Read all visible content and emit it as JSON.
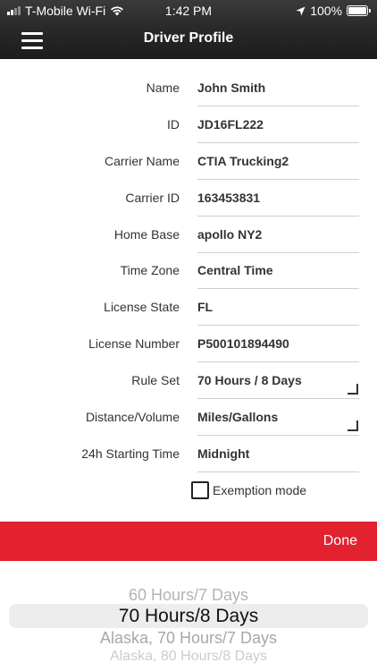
{
  "status_bar": {
    "carrier": "T-Mobile Wi-Fi",
    "time": "1:42 PM",
    "battery": "100%"
  },
  "header": {
    "title": "Driver Profile"
  },
  "fields": [
    {
      "label": "Name",
      "value": "John Smith"
    },
    {
      "label": "ID",
      "value": "JD16FL222"
    },
    {
      "label": "Carrier Name",
      "value": "CTIA Trucking2"
    },
    {
      "label": "Carrier ID",
      "value": "163453831"
    },
    {
      "label": "Home Base",
      "value": "apollo NY2"
    },
    {
      "label": "Time Zone",
      "value": "Central Time"
    },
    {
      "label": "License State",
      "value": "FL"
    },
    {
      "label": "License Number",
      "value": "P500101894490"
    },
    {
      "label": "Rule Set",
      "value": "70 Hours / 8 Days"
    },
    {
      "label": "Distance/Volume",
      "value": "Miles/Gallons"
    },
    {
      "label": "24h Starting Time",
      "value": "Midnight"
    }
  ],
  "exemption": {
    "label": "Exemption mode",
    "checked": false
  },
  "done_bar": {
    "done_label": "Done",
    "color": "#e3222f"
  },
  "picker": {
    "options": [
      "60 Hours/7 Days",
      "70 Hours/8 Days",
      "Alaska, 70 Hours/7 Days",
      "Alaska, 80 Hours/8 Days"
    ],
    "selected": "70 Hours/8 Days"
  }
}
